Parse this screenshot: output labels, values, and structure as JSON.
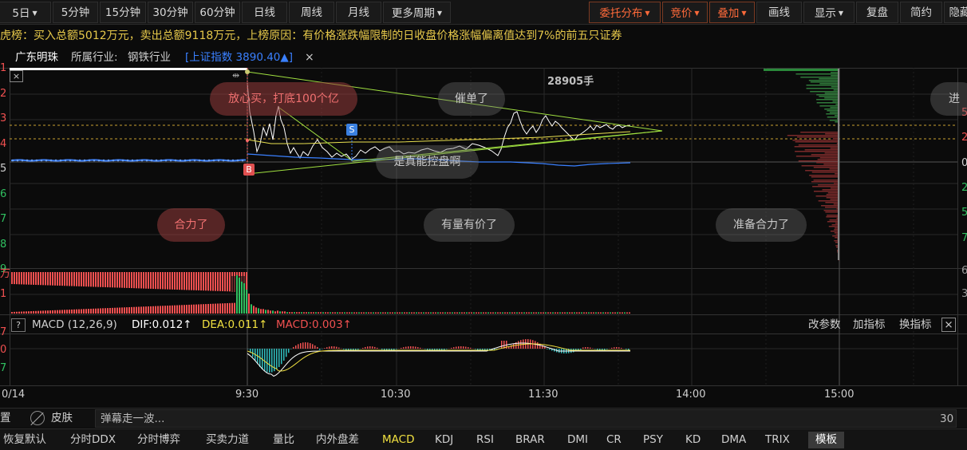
{
  "toolbar": {
    "periods": [
      "5日",
      "5分钟",
      "15分钟",
      "30分钟",
      "60分钟",
      "日线",
      "周线",
      "月线",
      "更多周期"
    ],
    "right": [
      "委托分布",
      "竞价",
      "叠加",
      "画线",
      "显示",
      "复盘",
      "简约",
      "隐藏"
    ]
  },
  "info": {
    "text": "虎榜：买入总额5012万元，卖出总额9118万元，上榜原因：有价格涨跌幅限制的日收盘价格涨幅偏离值达到7%的前五只证券"
  },
  "stock": {
    "name": "广东明珠",
    "industry_label": "所属行业:",
    "industry": "钢铁行业",
    "index": "[上证指数 3890.40▲]",
    "close_symbol": "×"
  },
  "left_axis": [
    "1",
    "2",
    "3",
    "4",
    "5",
    "6",
    "7",
    "8",
    "9"
  ],
  "right_axis": [
    "5",
    "2",
    "0",
    "2",
    "5",
    "7"
  ],
  "vol_axis": {
    "left": [
      "万",
      "1"
    ],
    "right": [
      "6",
      "3"
    ]
  },
  "macd_axis": {
    "left": [
      "7",
      "0",
      "7"
    ]
  },
  "time_axis": [
    "0/14",
    "9:30",
    "10:30",
    "11:30",
    "14:00",
    "15:00"
  ],
  "annotations": {
    "volume_peak": "28905手",
    "buy_marker": "B",
    "sell_marker": "S",
    "zoom_icon": "⇹"
  },
  "bubbles": [
    "放心买，打底100个亿",
    "催单了",
    "进",
    "是真能控盘啊",
    "合力了",
    "有量有价了",
    "准备合力了"
  ],
  "macd": {
    "help": "?",
    "title": "MACD (12,26,9)",
    "dif": "DIF:0.012↑",
    "dea": "DEA:0.011↑",
    "macd": "MACD:0.003↑",
    "actions": [
      "改参数",
      "加指标",
      "换指标"
    ],
    "close": "×"
  },
  "danmu": {
    "left": "置",
    "skin": "皮肤",
    "placeholder": "弹幕走一波...",
    "count": "30"
  },
  "bottom": {
    "tabs": [
      "恢复默认",
      "分时DDX",
      "分时博弈",
      "买卖力道",
      "量比",
      "内外盘差",
      "MACD",
      "KDJ",
      "RSI",
      "BRAR",
      "DMI",
      "CR",
      "PSY",
      "KD",
      "DMA",
      "TRIX",
      "模板"
    ],
    "active": "MACD"
  },
  "colors": {
    "up": "#f05050",
    "down": "#30c060",
    "accent": "#ff6a3a",
    "price": "#ffffff",
    "avg": "#e8e050",
    "index": "#3a80ff",
    "macd_yellow": "#f0e040"
  }
}
